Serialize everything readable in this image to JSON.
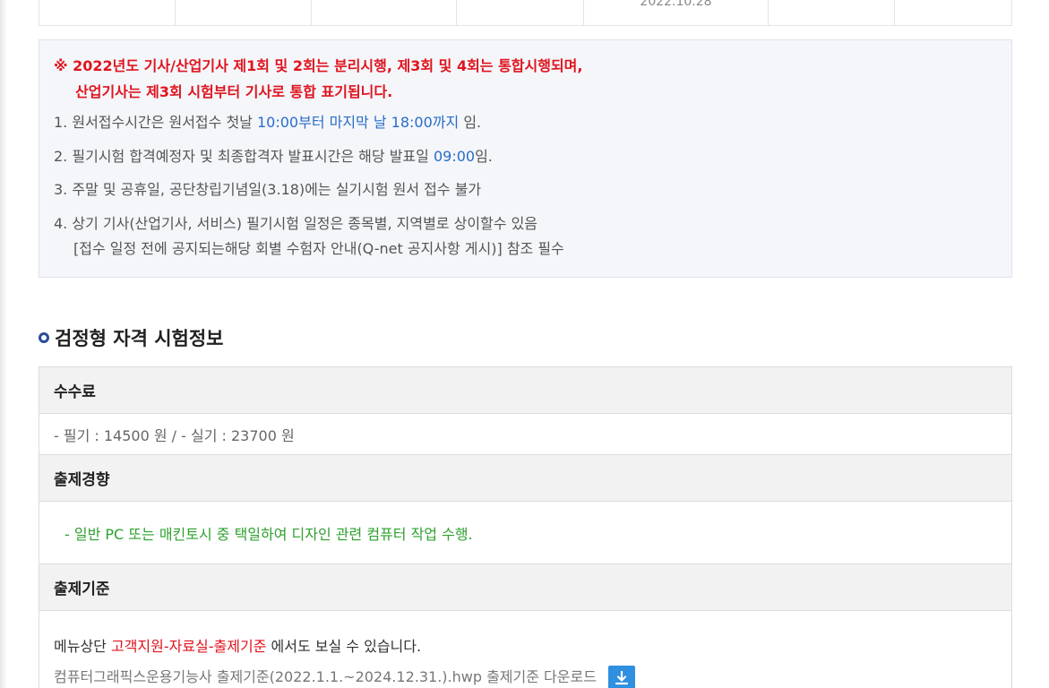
{
  "top_table": {
    "date": "2022.10.28"
  },
  "notice": {
    "warning_line1": "※ 2022년도 기사/산업기사 제1회 및 2회는 분리시행, 제3회 및 4회는 통합시행되며,",
    "warning_line2": "산업기사는 제3회 시험부터 기사로 통합 표기됩니다.",
    "item1_prefix": "1. 원서접수시간은 원서접수 첫날 ",
    "item1_hl1": "10:00부터 마지막 날 18:00까지",
    "item1_suffix": " 임.",
    "item2_prefix": "2. 필기시험 합격예정자 및 최종합격자 발표시간은 해당 발표일 ",
    "item2_hl": "09:00",
    "item2_suffix": "임.",
    "item3": "3. 주말 및 공휴일, 공단창립기념일(3.18)에는 실기시험 원서 접수 불가",
    "item4": "4. 상기 기사(산업기사, 서비스) 필기시험 일정은 종목별, 지역별로 상이할수 있음",
    "item4_sub": "[접수 일정 전에 공지되는해당 회별 수험자 안내(Q-net 공지사항 게시)] 참조 필수"
  },
  "section": {
    "title": "검정형 자격 시험정보"
  },
  "info": {
    "fee_head": "수수료",
    "fee_body": "- 필기 : 14500 원 / - 실기 : 23700 원",
    "trend_head": "출제경향",
    "trend_body": "- 일반 PC 또는 매킨토시 중 택일하여 디자인 관련 컴퓨터 작업 수행.",
    "standard_head": "출제기준",
    "standard_line1_prefix": "메뉴상단 ",
    "standard_line1_link": "고객지원-자료실-출제기준",
    "standard_line1_suffix": " 에서도 보실 수 있습니다.",
    "standard_file": "컴퓨터그래픽스운용기능사 출제기준(2022.1.1.~2024.12.31.).hwp 출제기준 다운로드",
    "download_icon": "download-icon"
  }
}
